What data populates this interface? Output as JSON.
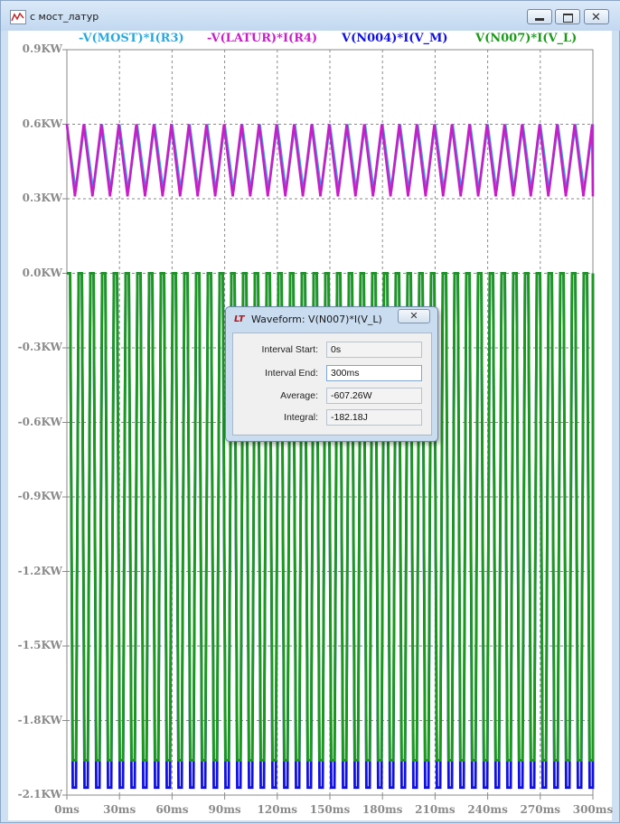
{
  "window": {
    "title": "с мост_латур"
  },
  "chart_data": {
    "type": "line",
    "x_axis": {
      "min": 0,
      "max": 300,
      "unit": "ms",
      "ticks": [
        0,
        30,
        60,
        90,
        120,
        150,
        180,
        210,
        240,
        270,
        300
      ],
      "tick_labels": [
        "0ms",
        "30ms",
        "60ms",
        "90ms",
        "120ms",
        "150ms",
        "180ms",
        "210ms",
        "240ms",
        "270ms",
        "300ms"
      ]
    },
    "y_axis": {
      "min": -2.1,
      "max": 0.9,
      "unit": "KW",
      "ticks": [
        0.9,
        0.6,
        0.3,
        0.0,
        -0.3,
        -0.6,
        -0.9,
        -1.2,
        -1.5,
        -1.8,
        -2.1
      ],
      "tick_labels": [
        "0.9KW",
        "0.6KW",
        "0.3KW",
        "0.0KW",
        "-0.3KW",
        "-0.6KW",
        "-0.9KW",
        "-1.2KW",
        "-1.5KW",
        "-1.8KW",
        "-2.1KW"
      ]
    },
    "grid": true,
    "series": [
      {
        "name": "-V(MOST)*I(R3)",
        "color": "#29a8e0",
        "shape": "triangle",
        "period_ms": 10,
        "min_kw": 0.33,
        "max_kw": 0.6,
        "phase_ms": 0
      },
      {
        "name": "-V(LATUR)*I(R4)",
        "color": "#c81ec8",
        "shape": "triangle",
        "period_ms": 10,
        "min_kw": 0.31,
        "max_kw": 0.6,
        "phase_ms": 0.4
      },
      {
        "name": "V(N004)*I(V_M)",
        "color": "#1010e0",
        "shape": "square",
        "period_ms": 6.7,
        "min_kw": -2.07,
        "max_kw": 0.0
      },
      {
        "name": "V(N007)*I(V_L)",
        "color": "#1a9a1a",
        "shape": "square",
        "period_ms": 6.7,
        "min_kw": -1.96,
        "max_kw": 0.0
      }
    ]
  },
  "dialog": {
    "logo": "LT",
    "title": "Waveform: V(N007)*I(V_L)",
    "close_label": "✕",
    "rows": [
      {
        "label": "Interval Start:",
        "value": "0s"
      },
      {
        "label": "Interval End:",
        "value": "300ms"
      },
      {
        "label": "Average:",
        "value": "-607.26W"
      },
      {
        "label": "Integral:",
        "value": "-182.18J"
      }
    ]
  }
}
